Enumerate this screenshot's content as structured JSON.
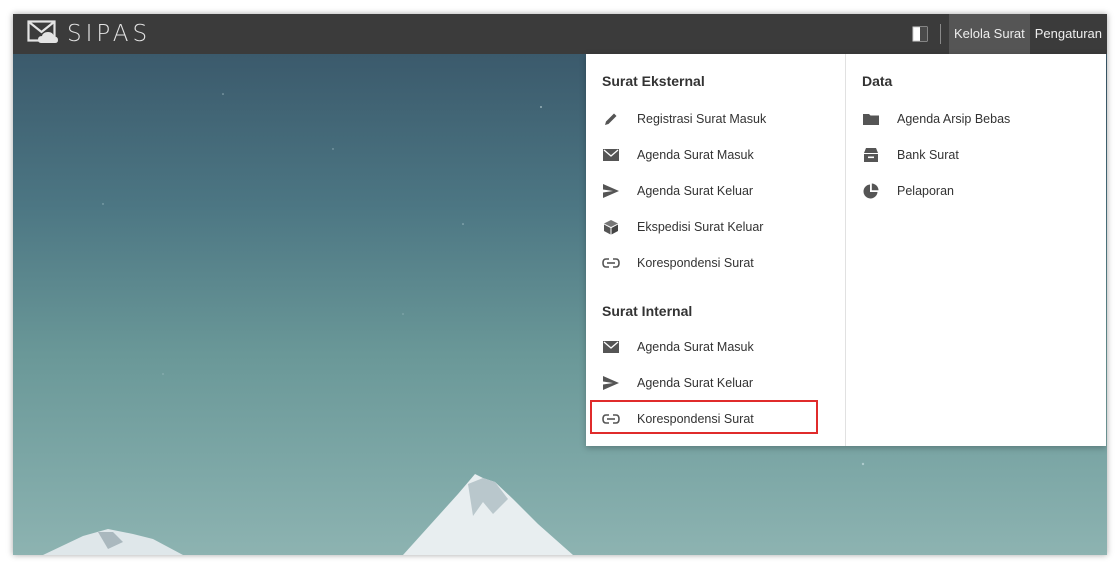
{
  "app": {
    "name": "SIPAS"
  },
  "topbar": {
    "nav": [
      {
        "label": "Kelola Surat",
        "active": true
      },
      {
        "label": "Pengaturan",
        "active": false
      }
    ]
  },
  "dropdown": {
    "left": {
      "sections": [
        {
          "title": "Surat Eksternal",
          "items": [
            {
              "label": "Registrasi Surat Masuk",
              "icon": "pencil-icon"
            },
            {
              "label": "Agenda Surat Masuk",
              "icon": "envelope-icon"
            },
            {
              "label": "Agenda Surat Keluar",
              "icon": "send-icon"
            },
            {
              "label": "Ekspedisi Surat Keluar",
              "icon": "package-icon"
            },
            {
              "label": "Korespondensi Surat",
              "icon": "link-icon"
            }
          ]
        },
        {
          "title": "Surat Internal",
          "items": [
            {
              "label": "Agenda Surat Masuk",
              "icon": "envelope-icon"
            },
            {
              "label": "Agenda Surat Keluar",
              "icon": "send-icon"
            },
            {
              "label": "Korespondensi Surat",
              "icon": "link-icon",
              "highlighted": true
            }
          ]
        }
      ]
    },
    "right": {
      "title": "Data",
      "items": [
        {
          "label": "Agenda Arsip Bebas",
          "icon": "folder-icon"
        },
        {
          "label": "Bank Surat",
          "icon": "archive-icon"
        },
        {
          "label": "Pelaporan",
          "icon": "pie-chart-icon"
        }
      ]
    }
  },
  "colors": {
    "topbar": "#3b3b3b",
    "highlight": "#e02b2b",
    "icon": "#555555"
  }
}
